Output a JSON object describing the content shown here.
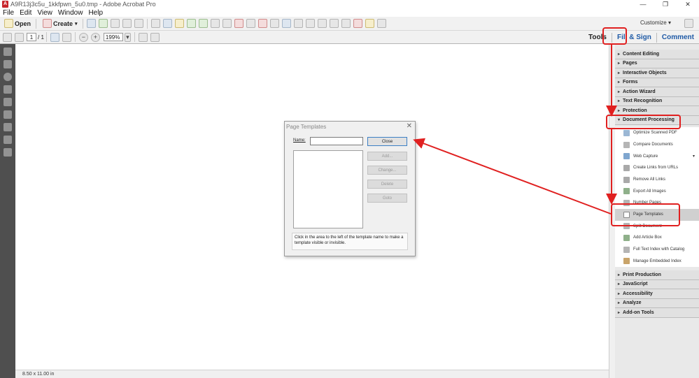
{
  "window": {
    "title": "A9R13j3c5u_1kkfpwn_5u0.tmp - Adobe Acrobat Pro",
    "controls": [
      "—",
      "❐",
      "✕"
    ]
  },
  "menu": [
    "File",
    "Edit",
    "View",
    "Window",
    "Help"
  ],
  "toolbar": {
    "open_label": "Open",
    "create_label": "Create",
    "customize_label": "Customize"
  },
  "nav": {
    "page_current": "1",
    "page_total": "/ 1",
    "zoom": "199%"
  },
  "tabs": {
    "tools": "Tools",
    "fill_sign": "Fill & Sign",
    "comment": "Comment"
  },
  "status": {
    "page_size": "8.50 x 11.00 in"
  },
  "panel": {
    "sections_top": [
      "Content Editing",
      "Pages",
      "Interactive Objects",
      "Forms",
      "Action Wizard",
      "Text Recognition",
      "Protection"
    ],
    "open_section": "Document Processing",
    "items": [
      "Optimize Scanned PDF",
      "Compare Documents",
      "Web Capture",
      "Create Links from URLs",
      "Remove All Links",
      "Export All Images",
      "Number Pages",
      "Page Templates",
      "Split Document",
      "Add Article Box",
      "Full Text Index with Catalog",
      "Manage Embedded Index"
    ],
    "sections_bottom": [
      "Print Production",
      "JavaScript",
      "Accessibility",
      "Analyze",
      "Add-on Tools"
    ]
  },
  "dialog": {
    "title": "Page Templates",
    "name_label": "Name:",
    "close_btn": "Close",
    "add_btn": "Add...",
    "change_btn": "Change...",
    "delete_btn": "Delete",
    "goto_btn": "Goto",
    "hint": "Click in the area to the left of the template name to make a template visible or invisible."
  },
  "colors": {
    "highlight": "#e02020",
    "tab_blue": "#1f5aa6",
    "rail": "#4f4f4f"
  }
}
